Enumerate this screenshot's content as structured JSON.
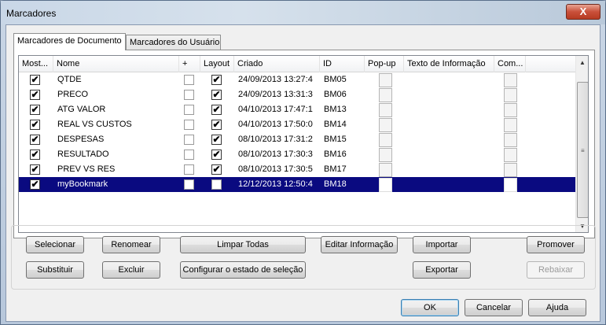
{
  "window": {
    "title": "Marcadores",
    "close_label": "X"
  },
  "tabs": [
    {
      "label": "Marcadores de Documento"
    },
    {
      "label": "Marcadores do Usuário"
    }
  ],
  "columns": [
    "Most...",
    "Nome",
    "+",
    "Layout",
    "Criado",
    "ID",
    "Pop-up",
    "Texto de Informação",
    "Com..."
  ],
  "rows": [
    {
      "show": true,
      "name": "QTDE",
      "plus": false,
      "layout": true,
      "created": "24/09/2013 13:27:4",
      "id": "BM05",
      "popup": "",
      "info": "",
      "com": "",
      "selected": false
    },
    {
      "show": true,
      "name": "PRECO",
      "plus": false,
      "layout": true,
      "created": "24/09/2013 13:31:3",
      "id": "BM06",
      "popup": "",
      "info": "",
      "com": "",
      "selected": false
    },
    {
      "show": true,
      "name": "ATG VALOR",
      "plus": false,
      "layout": true,
      "created": "04/10/2013 17:47:1",
      "id": "BM13",
      "popup": "",
      "info": "",
      "com": "",
      "selected": false
    },
    {
      "show": true,
      "name": "REAL VS CUSTOS",
      "plus": false,
      "layout": true,
      "created": "04/10/2013 17:50:0",
      "id": "BM14",
      "popup": "",
      "info": "",
      "com": "",
      "selected": false
    },
    {
      "show": true,
      "name": "DESPESAS",
      "plus": false,
      "layout": true,
      "created": "08/10/2013 17:31:2",
      "id": "BM15",
      "popup": "",
      "info": "",
      "com": "",
      "selected": false
    },
    {
      "show": true,
      "name": "RESULTADO",
      "plus": false,
      "layout": true,
      "created": "08/10/2013 17:30:3",
      "id": "BM16",
      "popup": "",
      "info": "",
      "com": "",
      "selected": false
    },
    {
      "show": true,
      "name": "PREV VS RES",
      "plus": false,
      "layout": true,
      "created": "08/10/2013 17:30:5",
      "id": "BM17",
      "popup": "",
      "info": "",
      "com": "",
      "selected": false
    },
    {
      "show": true,
      "name": "myBookmark",
      "plus": false,
      "layout": false,
      "created": "12/12/2013 12:50:4",
      "id": "BM18",
      "popup": "",
      "info": "",
      "com": "",
      "selected": true
    }
  ],
  "check_glyph": "✔",
  "scroll": {
    "up": "▲",
    "down": "▼",
    "grip": "≡"
  },
  "buttons": {
    "select": "Selecionar",
    "rename": "Renomear",
    "clear_all": "Limpar Todas",
    "edit_info": "Editar Informação",
    "import": "Importar",
    "promote": "Promover",
    "replace": "Substituir",
    "delete": "Excluir",
    "configure": "Configurar o estado de seleção",
    "export": "Exportar",
    "demote": "Rebaixar",
    "ok": "OK",
    "cancel": "Cancelar",
    "help": "Ajuda"
  }
}
